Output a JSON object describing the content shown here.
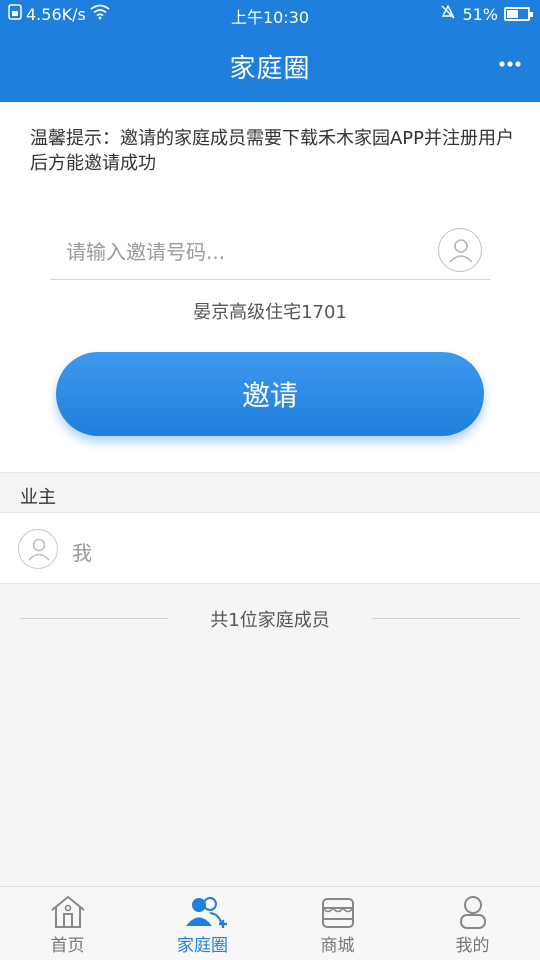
{
  "status_bar": {
    "speed": "4.56K/s",
    "time": "上午10:30",
    "battery": "51%"
  },
  "header": {
    "title": "家庭圈",
    "more_icon": "more-icon"
  },
  "tip": "温馨提示：邀请的家庭成员需要下载禾木家园APP并注册用户后方能邀请成功",
  "invite_form": {
    "placeholder": "请输入邀请号码...",
    "value": "",
    "address": "晏京高级住宅1701",
    "button_label": "邀请"
  },
  "owner_section": {
    "title": "业主",
    "members": [
      {
        "name": "我"
      }
    ],
    "count_text": "共1位家庭成员"
  },
  "tabbar": {
    "items": [
      {
        "label": "首页",
        "icon": "home-icon",
        "active": false
      },
      {
        "label": "家庭圈",
        "icon": "family-icon",
        "active": true
      },
      {
        "label": "商城",
        "icon": "store-icon",
        "active": false
      },
      {
        "label": "我的",
        "icon": "profile-icon",
        "active": false
      }
    ]
  },
  "colors": {
    "primary": "#1e7fdc"
  }
}
